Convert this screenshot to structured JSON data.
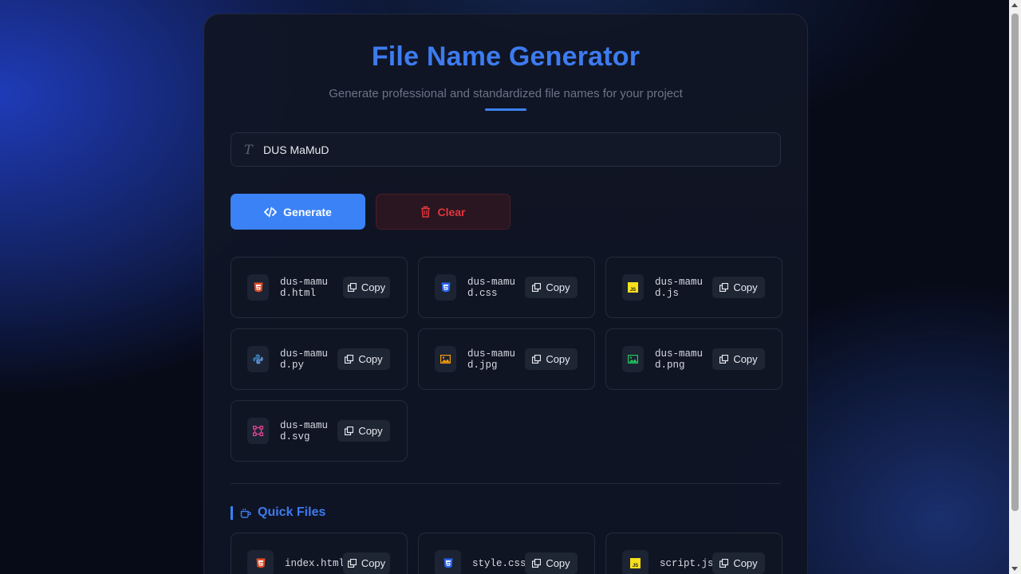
{
  "header": {
    "title": "File Name Generator",
    "subtitle": "Generate professional and standardized file names for your project"
  },
  "input": {
    "value": "DUS MaMuD",
    "icon": "text-icon"
  },
  "actions": {
    "generate_label": "Generate",
    "clear_label": "Clear"
  },
  "generated": [
    {
      "name": "dus-mamud.html",
      "icon": "html5-icon",
      "color": "#e34c26",
      "copy": "Copy"
    },
    {
      "name": "dus-mamud.css",
      "icon": "css3-icon",
      "color": "#2965f1",
      "copy": "Copy"
    },
    {
      "name": "dus-mamud.js",
      "icon": "js-icon",
      "color": "#f7df1e",
      "copy": "Copy"
    },
    {
      "name": "dus-mamud.py",
      "icon": "python-icon",
      "color": "#3776ab",
      "copy": "Copy"
    },
    {
      "name": "dus-mamud.jpg",
      "icon": "image-icon",
      "color": "#f59e0b",
      "copy": "Copy"
    },
    {
      "name": "dus-mamud.png",
      "icon": "image-icon",
      "color": "#22c55e",
      "copy": "Copy"
    },
    {
      "name": "dus-mamud.svg",
      "icon": "vector-icon",
      "color": "#ec4899",
      "copy": "Copy"
    }
  ],
  "quick": {
    "title": "Quick Files",
    "items": [
      {
        "name": "index.html",
        "icon": "html5-icon",
        "copy": "Copy"
      },
      {
        "name": "style.css",
        "icon": "css3-icon",
        "copy": "Copy"
      },
      {
        "name": "script.js",
        "icon": "js-icon",
        "copy": "Copy"
      }
    ]
  },
  "colors": {
    "accent": "#3b82f6",
    "danger": "#e0363f"
  }
}
